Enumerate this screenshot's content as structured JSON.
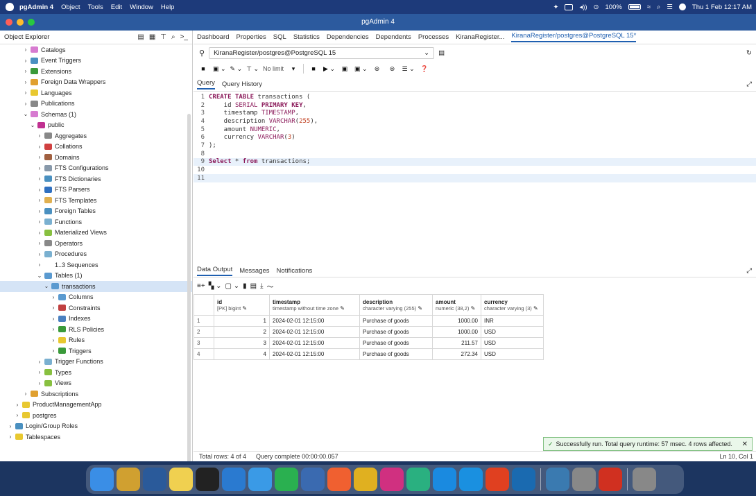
{
  "menubar": {
    "app": "pgAdmin 4",
    "items": [
      "Object",
      "Tools",
      "Edit",
      "Window",
      "Help"
    ],
    "battery": "100%",
    "clock": "Thu 1 Feb 12:17 AM"
  },
  "window": {
    "title": "pgAdmin 4"
  },
  "explorer": {
    "title": "Object Explorer",
    "tree": [
      {
        "label": "Catalogs",
        "depth": 2,
        "chev": "›",
        "color": "#d77bd0"
      },
      {
        "label": "Event Triggers",
        "depth": 2,
        "chev": "›",
        "color": "#4a90c0"
      },
      {
        "label": "Extensions",
        "depth": 2,
        "chev": "›",
        "color": "#3a9a3a"
      },
      {
        "label": "Foreign Data Wrappers",
        "depth": 2,
        "chev": "›",
        "color": "#e0a030"
      },
      {
        "label": "Languages",
        "depth": 2,
        "chev": "›",
        "color": "#e8c830"
      },
      {
        "label": "Publications",
        "depth": 2,
        "chev": "›",
        "color": "#888888"
      },
      {
        "label": "Schemas (1)",
        "depth": 2,
        "chev": "⌄",
        "color": "#d77bd0"
      },
      {
        "label": "public",
        "depth": 3,
        "chev": "⌄",
        "color": "#c03090"
      },
      {
        "label": "Aggregates",
        "depth": 4,
        "chev": "›",
        "color": "#888888"
      },
      {
        "label": "Collations",
        "depth": 4,
        "chev": "›",
        "color": "#d04040"
      },
      {
        "label": "Domains",
        "depth": 4,
        "chev": "›",
        "color": "#a06040"
      },
      {
        "label": "FTS Configurations",
        "depth": 4,
        "chev": "›",
        "color": "#8899aa"
      },
      {
        "label": "FTS Dictionaries",
        "depth": 4,
        "chev": "›",
        "color": "#4a90c0"
      },
      {
        "label": "FTS Parsers",
        "depth": 4,
        "chev": "›",
        "color": "#3070c0"
      },
      {
        "label": "FTS Templates",
        "depth": 4,
        "chev": "›",
        "color": "#e0b050"
      },
      {
        "label": "Foreign Tables",
        "depth": 4,
        "chev": "›",
        "color": "#4a90c0"
      },
      {
        "label": "Functions",
        "depth": 4,
        "chev": "›",
        "color": "#7ab0d0"
      },
      {
        "label": "Materialized Views",
        "depth": 4,
        "chev": "›",
        "color": "#88c040"
      },
      {
        "label": "Operators",
        "depth": 4,
        "chev": "›",
        "color": "#888888"
      },
      {
        "label": "Procedures",
        "depth": 4,
        "chev": "›",
        "color": "#7ab0d0"
      },
      {
        "label": "1..3 Sequences",
        "depth": 4,
        "chev": "›",
        "color": "#ffffff"
      },
      {
        "label": "Tables (1)",
        "depth": 4,
        "chev": "⌄",
        "color": "#5a9ad0"
      },
      {
        "label": "transactions",
        "depth": 5,
        "chev": "⌄",
        "color": "#5a9ad0",
        "selected": true
      },
      {
        "label": "Columns",
        "depth": 6,
        "chev": "›",
        "color": "#5a9ad0"
      },
      {
        "label": "Constraints",
        "depth": 6,
        "chev": "›",
        "color": "#c04040"
      },
      {
        "label": "Indexes",
        "depth": 6,
        "chev": "›",
        "color": "#4a80c0"
      },
      {
        "label": "RLS Policies",
        "depth": 6,
        "chev": "›",
        "color": "#3a9a3a"
      },
      {
        "label": "Rules",
        "depth": 6,
        "chev": "›",
        "color": "#e8c830"
      },
      {
        "label": "Triggers",
        "depth": 6,
        "chev": "›",
        "color": "#3a9a3a"
      },
      {
        "label": "Trigger Functions",
        "depth": 4,
        "chev": "›",
        "color": "#7ab0d0"
      },
      {
        "label": "Types",
        "depth": 4,
        "chev": "›",
        "color": "#88c040"
      },
      {
        "label": "Views",
        "depth": 4,
        "chev": "›",
        "color": "#88c040"
      },
      {
        "label": "Subscriptions",
        "depth": 2,
        "chev": "›",
        "color": "#e0a030"
      },
      {
        "label": "ProductManagementApp",
        "depth": 1,
        "chev": "›",
        "color": "#e8c830"
      },
      {
        "label": "postgres",
        "depth": 1,
        "chev": "›",
        "color": "#e8c830"
      },
      {
        "label": "Login/Group Roles",
        "depth": 0,
        "chev": "›",
        "color": "#4a90c0"
      },
      {
        "label": "Tablespaces",
        "depth": 0,
        "chev": "›",
        "color": "#e8c830"
      }
    ]
  },
  "tabs": [
    "Dashboard",
    "Properties",
    "SQL",
    "Statistics",
    "Dependencies",
    "Dependents",
    "Processes",
    "KiranaRegister...",
    "KiranaRegister/postgres@PostgreSQL 15*"
  ],
  "connection": "KiranaRegister/postgres@PostgreSQL 15",
  "toolbar": {
    "limit": "No limit"
  },
  "subtabs": [
    "Query",
    "Query History"
  ],
  "editor": {
    "lines": [
      "CREATE TABLE transactions (",
      "    id SERIAL PRIMARY KEY,",
      "    timestamp TIMESTAMP,",
      "    description VARCHAR(255),",
      "    amount NUMERIC,",
      "    currency VARCHAR(3)",
      ");",
      "",
      "Select * from transactions;",
      "",
      ""
    ]
  },
  "results": {
    "tabs": [
      "Data Output",
      "Messages",
      "Notifications"
    ],
    "columns": [
      {
        "name": "id",
        "type": "[PK] bigint"
      },
      {
        "name": "timestamp",
        "type": "timestamp without time zone"
      },
      {
        "name": "description",
        "type": "character varying (255)"
      },
      {
        "name": "amount",
        "type": "numeric (38,2)"
      },
      {
        "name": "currency",
        "type": "character varying (3)"
      }
    ],
    "rows": [
      [
        "1",
        "1",
        "2024-02-01 12:15:00",
        "Purchase of goods",
        "1000.00",
        "INR"
      ],
      [
        "2",
        "2",
        "2024-02-01 12:15:00",
        "Purchase of goods",
        "1000.00",
        "USD"
      ],
      [
        "3",
        "3",
        "2024-02-01 12:15:00",
        "Purchase of goods",
        "211.57",
        "USD"
      ],
      [
        "4",
        "4",
        "2024-02-01 12:15:00",
        "Purchase of goods",
        "272.34",
        "USD"
      ]
    ]
  },
  "toast": "Successfully run. Total query runtime: 57 msec. 4 rows affected.",
  "status": {
    "rows": "Total rows: 4 of 4",
    "query": "Query complete 00:00:00.057",
    "position": "Ln 10, Col 1"
  },
  "dock": [
    {
      "name": "finder-icon",
      "color": "#3a8ee6"
    },
    {
      "name": "launchpad-icon",
      "color": "#d0a030"
    },
    {
      "name": "pgadmin-icon",
      "color": "#2a5a9a"
    },
    {
      "name": "notes-icon",
      "color": "#f0d050"
    },
    {
      "name": "terminal-icon",
      "color": "#222222"
    },
    {
      "name": "vscode-icon",
      "color": "#2a7ad0"
    },
    {
      "name": "safari-icon",
      "color": "#3a9ae6"
    },
    {
      "name": "whatsapp-icon",
      "color": "#2ab050"
    },
    {
      "name": "pgadmin2-icon",
      "color": "#3a6ab0"
    },
    {
      "name": "swift-icon",
      "color": "#f06030"
    },
    {
      "name": "chrome-icon",
      "color": "#e0b020"
    },
    {
      "name": "intellij-icon",
      "color": "#d03080"
    },
    {
      "name": "datagrip-icon",
      "color": "#2ab080"
    },
    {
      "name": "primevideo-icon",
      "color": "#1a8ae0"
    },
    {
      "name": "docker-icon",
      "color": "#1a90e0"
    },
    {
      "name": "brave-icon",
      "color": "#e04020"
    },
    {
      "name": "linkedin-icon",
      "color": "#1a6ab0"
    },
    {
      "name": "preview-icon",
      "color": "#3a7ab0"
    },
    {
      "name": "settings-icon",
      "color": "#888888"
    },
    {
      "name": "redisinsight-icon",
      "color": "#d03020"
    },
    {
      "name": "trash-icon",
      "color": "#888888"
    }
  ]
}
